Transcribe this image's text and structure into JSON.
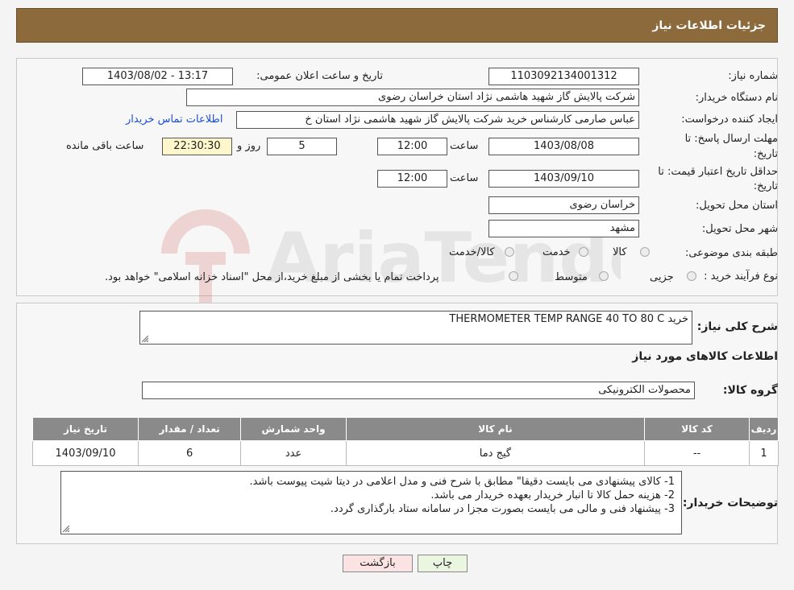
{
  "header": {
    "title": "جزئیات اطلاعات نیاز"
  },
  "form": {
    "need_number_label": "شماره نیاز:",
    "need_number": "1103092134001312",
    "announce_label": "تاریخ و ساعت اعلان عمومی:",
    "announce_value": "1403/08/02 - 13:17",
    "buyer_org_label": "نام دستگاه خریدار:",
    "buyer_org": "شرکت پالایش گاز شهید هاشمی نژاد   استان خراسان رضوی",
    "creator_label": "ایجاد کننده درخواست:",
    "creator": "عباس صارمی کارشناس خرید  شرکت پالایش گاز شهید هاشمی نژاد   استان خ",
    "contact_link": "اطلاعات تماس خریدار",
    "deadline_label_1": "مهلت ارسال پاسخ: تا",
    "deadline_label_2": "تاریخ:",
    "deadline_date": "1403/08/08",
    "time_label": "ساعت",
    "deadline_time": "12:00",
    "days_value": "5",
    "days_label": "روز و",
    "remaining_time": "22:30:30",
    "remaining_label": "ساعت باقی مانده",
    "validity_label_1": "حداقل تاریخ اعتبار قیمت: تا",
    "validity_label_2": "تاریخ:",
    "validity_date": "1403/09/10",
    "validity_time": "12:00",
    "province_label": "استان محل تحویل:",
    "province": "خراسان رضوی",
    "city_label": "شهر محل تحویل:",
    "city": "مشهد",
    "category_label": "طبقه بندی موضوعی:",
    "category_options": [
      "کالا",
      "خدمت",
      "کالا/خدمت"
    ],
    "process_label": "نوع فرآیند خرید :",
    "process_options": [
      "جزیی",
      "متوسط"
    ],
    "process_note": "پرداخت تمام یا بخشی از مبلغ خرید،از محل \"اسناد خزانه اسلامی\" خواهد بود."
  },
  "details": {
    "summary_label": "شرح کلی نیاز:",
    "summary": "خرید THERMOMETER TEMP RANGE 40 TO 80 C",
    "goods_info_title": "اطلاعات کالاهای مورد نیاز",
    "group_label": "گروه کالا:",
    "group_value": "محصولات الکترونیکی",
    "table": {
      "headers": [
        "ردیف",
        "کد کالا",
        "نام کالا",
        "واحد شمارش",
        "تعداد / مقدار",
        "تاریخ نیاز"
      ],
      "rows": [
        [
          "1",
          "--",
          "گیج دما",
          "عدد",
          "6",
          "1403/09/10"
        ]
      ]
    },
    "notes_label": "توضیحات خریدار:",
    "notes": [
      "1-    کالای پیشنهادی می بایست دقیقا\" مطابق با شرح فنی و مدل اعلامی در دیتا شیت پیوست باشد.",
      "2-    هزینه حمل کالا تا انبار خریدار بعهده خریدار می باشد.",
      "3-    پیشنهاد فنی و مالی می بایست بصورت مجزا در سامانه ستاد بارگذاری گردد."
    ]
  },
  "buttons": {
    "print": "چاپ",
    "back": "بازگشت"
  },
  "colors": {
    "header": "#8c6a3b",
    "print_bg": "#eaf6e0",
    "back_bg": "#fbe3e3",
    "link": "#1a4fd6"
  }
}
